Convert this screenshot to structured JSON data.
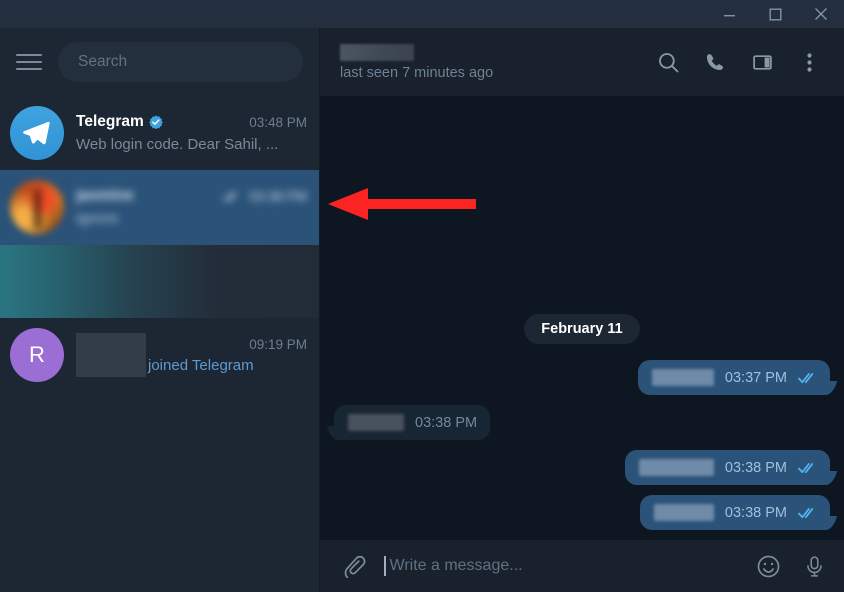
{
  "window": {
    "controls": [
      {
        "name": "minimize",
        "label": "Minimize"
      },
      {
        "name": "maximize",
        "label": "Maximize"
      },
      {
        "name": "close",
        "label": "Close"
      }
    ]
  },
  "sidebar": {
    "menu_label": "Menu",
    "search": {
      "placeholder": "Search",
      "value": ""
    },
    "chats": [
      {
        "name": "Telegram",
        "verified": true,
        "time": "03:48 PM",
        "preview": "Web login code. Dear Sahil, ...",
        "avatar_type": "telegram-logo",
        "avatar_letter": "",
        "selected": false,
        "redacted": false,
        "has_ticks": false
      },
      {
        "name": "jasmine",
        "verified": false,
        "time": "03:38 PM",
        "preview": "Ignore",
        "avatar_type": "photo",
        "avatar_letter": "",
        "selected": true,
        "redacted": true,
        "has_ticks": true
      },
      {
        "name": "",
        "verified": false,
        "time": "",
        "preview": "",
        "avatar_type": "gradient",
        "avatar_letter": "",
        "selected": false,
        "redacted": true,
        "has_ticks": false
      },
      {
        "name": "",
        "verified": false,
        "time": "09:19 PM",
        "preview": "joined Telegram",
        "avatar_type": "letter",
        "avatar_letter": "R",
        "selected": false,
        "redacted": true,
        "has_ticks": false
      }
    ]
  },
  "chat_header": {
    "title": "",
    "title_redacted": true,
    "status": "last seen 7 minutes ago",
    "actions": [
      {
        "name": "search-icon",
        "label": "Search"
      },
      {
        "name": "phone-icon",
        "label": "Call"
      },
      {
        "name": "split-panel-icon",
        "label": "Chat info"
      },
      {
        "name": "more-menu-icon",
        "label": "More"
      }
    ]
  },
  "conversation": {
    "date_separator": "February 11",
    "messages": [
      {
        "direction": "out",
        "text": "",
        "redacted": true,
        "redact_width": 62,
        "time": "03:37 PM",
        "status": "read"
      },
      {
        "direction": "in",
        "text": "",
        "redacted": true,
        "redact_width": 56,
        "time": "03:38 PM",
        "status": ""
      },
      {
        "direction": "out",
        "text": "",
        "redacted": true,
        "redact_width": 75,
        "time": "03:38 PM",
        "status": "read"
      },
      {
        "direction": "out",
        "text": "",
        "redacted": true,
        "redact_width": 60,
        "time": "03:38 PM",
        "status": "read"
      }
    ]
  },
  "composer": {
    "attach_label": "Attach file",
    "placeholder": "Write a message...",
    "value": "",
    "emoji_label": "Emoji",
    "mic_label": "Record voice message"
  },
  "annotation": {
    "arrow": {
      "color": "#fc2323",
      "direction": "left",
      "points_to": "chat-row-jasmine"
    }
  },
  "colors": {
    "titlebar": "#232f3e",
    "sidebar_bg": "#1d2733",
    "chat_bg": "#0e1621",
    "header_bg": "#18212c",
    "selected_row": "#2b5278",
    "out_bubble": "#2b5278",
    "in_bubble": "#182533",
    "accent_blue": "#5c9ad2",
    "tick_blue": "#4fb4f0",
    "annotation_red": "#fc2323"
  }
}
